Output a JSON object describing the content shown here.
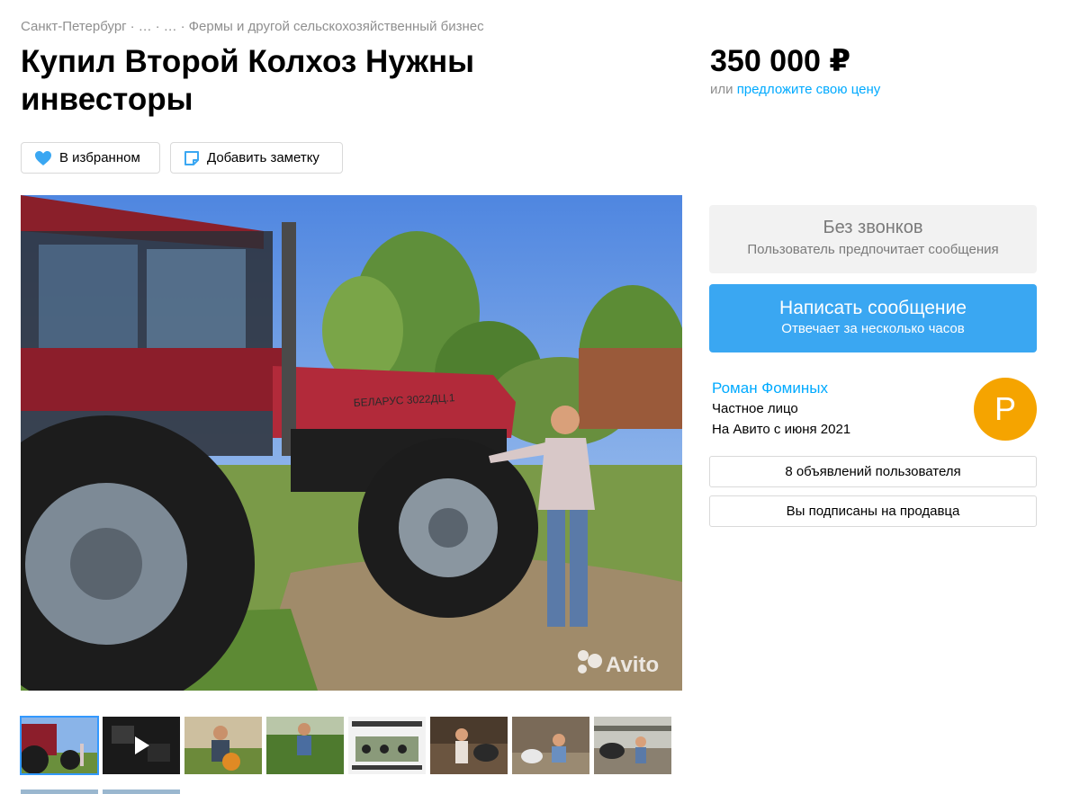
{
  "breadcrumbs": {
    "city": "Санкт-Петербург",
    "mid1": "…",
    "mid2": "…",
    "category": "Фермы и другой сельскохозяйственный бизнес",
    "separator": "·"
  },
  "listing": {
    "title": "Купил Второй Колхоз Нужны инвесторы",
    "price": "350 000 ₽",
    "offer_prefix": "или",
    "offer_link": "предложите свою цену"
  },
  "actions": {
    "favorite_label": "В избранном",
    "note_label": "Добавить заметку"
  },
  "gallery": {
    "watermark": "Avito",
    "tractor_text": "БЕЛАРУС 3022ДЦ.1",
    "thumb_count": 8
  },
  "contact": {
    "no_calls_title": "Без звонков",
    "no_calls_subtitle": "Пользователь предпочитает сообщения",
    "message_title": "Написать сообщение",
    "message_subtitle": "Отвечает за несколько часов"
  },
  "seller": {
    "name": "Роман Фоминых",
    "type": "Частное лицо",
    "since": "На Авито с июня 2021",
    "avatar_letter": "Р",
    "ads_label": "8 объявлений пользователя",
    "subscribed_label": "Вы подписаны на продавца"
  },
  "colors": {
    "link": "#00aaff",
    "primary_button": "#3aa7f2",
    "avatar": "#f5a400",
    "heart": "#3aa7f2"
  }
}
